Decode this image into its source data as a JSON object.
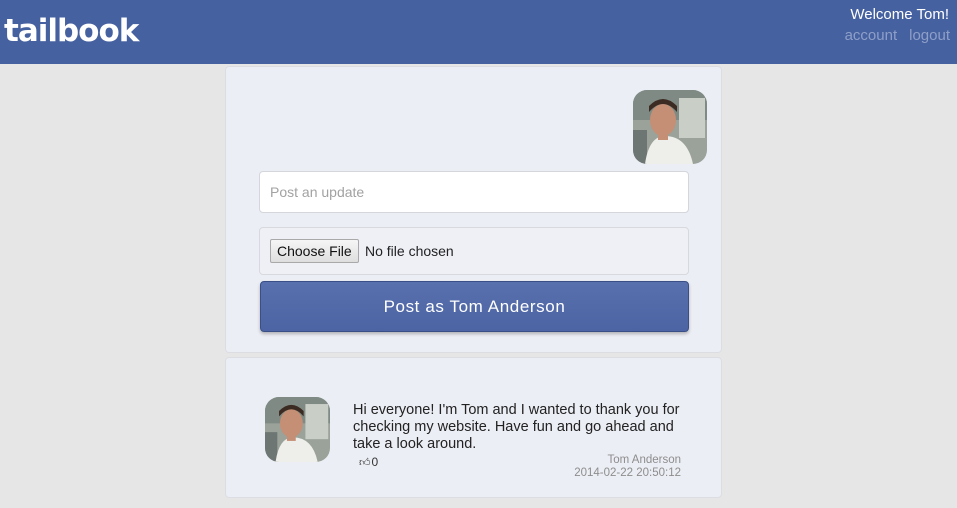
{
  "header": {
    "logo": "tailbook",
    "welcome": "Welcome Tom!",
    "links": {
      "account": "account",
      "logout": "logout"
    },
    "color": "#4661a0"
  },
  "compose": {
    "placeholder": "Post an update",
    "file_button": "Choose File",
    "file_status": "No file chosen",
    "post_button": "Post as Tom Anderson",
    "avatar_icon": "user-avatar-photo"
  },
  "feed": [
    {
      "text": "Hi everyone! I'm Tom and I wanted to thank you for checking my website. Have fun and go ahead and take a look around.",
      "likes": "0",
      "like_icon": "thumbs-up-icon",
      "author": "Tom Anderson",
      "timestamp": "2014-02-22 20:50:12",
      "avatar_icon": "user-avatar-photo"
    }
  ]
}
